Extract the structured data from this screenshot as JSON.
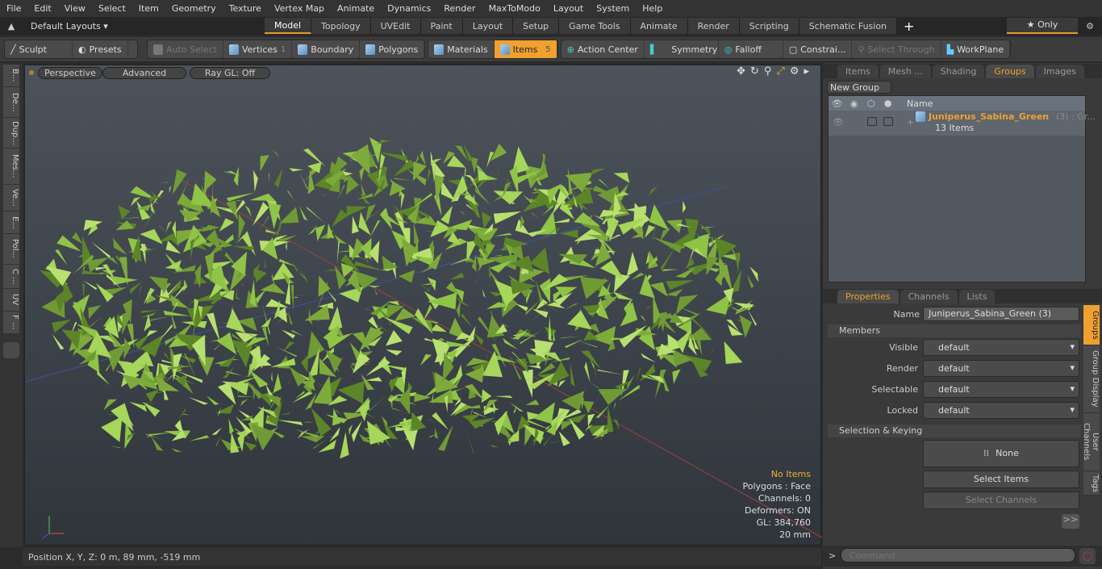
{
  "menu": [
    "File",
    "Edit",
    "View",
    "Select",
    "Item",
    "Geometry",
    "Texture",
    "Vertex Map",
    "Animate",
    "Dynamics",
    "Render",
    "MaxToModo",
    "Layout",
    "System",
    "Help"
  ],
  "layout": {
    "selector": "Default Layouts ▾",
    "tabs": [
      "Model",
      "Topology",
      "UVEdit",
      "Paint",
      "Layout",
      "Setup",
      "Game Tools",
      "Animate",
      "Render",
      "Scripting",
      "Schematic Fusion"
    ],
    "active": "Model",
    "plus": "+",
    "only": "★ Only"
  },
  "toolbar": {
    "sculpt": "Sculpt",
    "presets": "Presets",
    "auto_select": "Auto Select",
    "vertices": "Vertices",
    "vertices_count": "1",
    "boundary": "Boundary",
    "polygons": "Polygons",
    "materials": "Materials",
    "items": "Items",
    "items_count": "5",
    "action_center": "Action Center",
    "symmetry": "Symmetry",
    "falloff": "Falloff",
    "constraints": "Constrai...",
    "select_through": "Select Through",
    "workplane": "WorkPlane"
  },
  "left_tabs": [
    "B...",
    "De...",
    "Dup...",
    "Mes...",
    "Ve...",
    "E...",
    "Pol...",
    "C ...",
    "UV",
    "F ..."
  ],
  "viewport": {
    "perspective": "Perspective",
    "advanced": "Advanced",
    "raygl": "Ray GL: Off",
    "info": {
      "no_items": "No Items",
      "polygons": "Polygons : Face",
      "channels": "Channels: 0",
      "deformers": "Deformers: ON",
      "gl": "GL: 384,760",
      "scale": "20 mm"
    },
    "accent": "#f0a030",
    "foliage": "#8fc447"
  },
  "status": {
    "position": "Position X, Y, Z:  0 m, 89 mm, -519 mm"
  },
  "groups_panel": {
    "tabs": [
      "Items",
      "Mesh ...",
      "Shading",
      "Groups",
      "Images"
    ],
    "active": "Groups",
    "new_group": "New Group",
    "col_name": "Name",
    "row": {
      "name": "Juniperus_Sabina_Green",
      "suffix": "(3) : Gr...",
      "count": "13 Items"
    }
  },
  "properties": {
    "tabs": [
      "Properties",
      "Channels",
      "Lists"
    ],
    "active": "Properties",
    "name_label": "Name",
    "name_value": "Juniperus_Sabina_Green (3)",
    "members": "Members",
    "fields": [
      {
        "label": "Visible",
        "value": "default"
      },
      {
        "label": "Render",
        "value": "default"
      },
      {
        "label": "Selectable",
        "value": "default"
      },
      {
        "label": "Locked",
        "value": "default"
      }
    ],
    "selection_keying": "Selection & Keying",
    "none": "None",
    "select_items": "Select Items",
    "select_channels": "Select Channels",
    "more": ">>",
    "side_tabs": [
      "Groups",
      "Group Display",
      "User Channels",
      "Tags"
    ]
  },
  "command": {
    "prompt": ">",
    "placeholder": "Command"
  }
}
